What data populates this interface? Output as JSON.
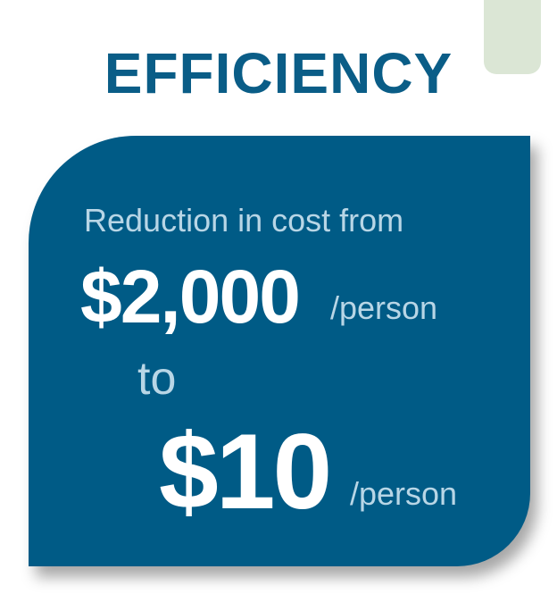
{
  "heading": "EFFICIENCY",
  "card": {
    "intro": "Reduction in cost from",
    "from_price": "$2,000",
    "from_unit": "/person",
    "connector": "to",
    "to_price": "$10",
    "to_unit": "/person"
  },
  "colors": {
    "heading": "#0a5d87",
    "card_background": "#005b86",
    "accent_tab": "#dbe6d5",
    "light_text": "#b8d6e6",
    "price_text": "#ffffff"
  }
}
